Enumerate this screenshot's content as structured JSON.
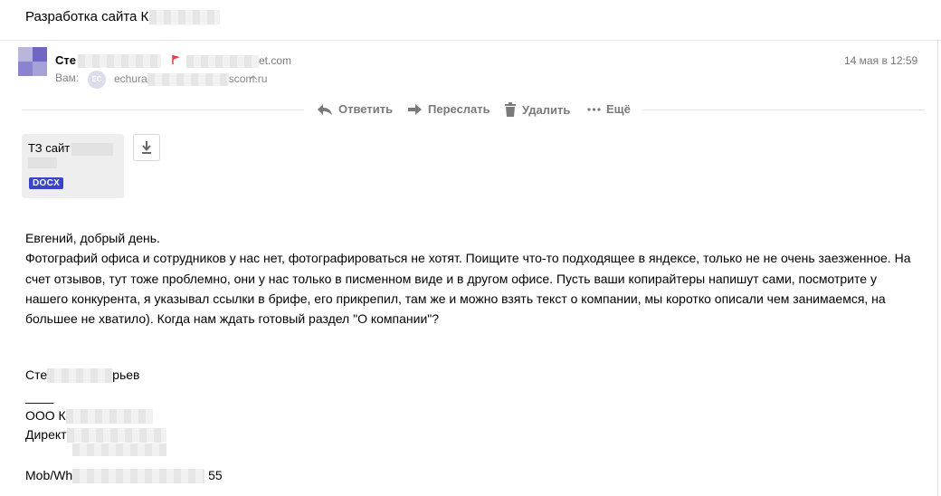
{
  "subject": {
    "text": "Разработка сайта К"
  },
  "sender": {
    "name": "Сте",
    "email_suffix": "et.com",
    "date": "14 мая в 12:59"
  },
  "recipient": {
    "label": "Вам:",
    "avatar_initials": "EC",
    "email_start": "echura",
    "email_end": "scom.ru"
  },
  "actions": {
    "reply": "Ответить",
    "forward": "Переслать",
    "delete": "Удалить",
    "more": "Ещё"
  },
  "attachment": {
    "name": "ТЗ  сайт",
    "type": "DOCX"
  },
  "message": {
    "greeting": "Евгений, добрый день.",
    "paragraph": "Фотографий офиса и сотрудников у нас нет, фотографироваться не хотят. Поищите что-то подходящее в яндексе, только не не очень заезженное. На счет отзывов, тут тоже проблемно, они у нас только в писменном виде и в другом офисе. Пусть ваши копирайтеры напишут сами, посмотрите у нашего конкурента, я указывал ссылки в брифе, его прикрепил, там же и можно взять текст о компании, мы коротко описали чем занимаемся, на большее не хватило). Когда нам ждать готовый раздел \"О компании\"?"
  },
  "signature": {
    "name_start": "Сте",
    "name_end": "рьев",
    "separator": "____",
    "company": "ООО К",
    "position": "Директ",
    "phone_start": "Mob/Wh",
    "phone_end": "55"
  },
  "colors": {
    "docx_badge": "#3a44c8",
    "action_text": "#7a7a7a",
    "meta_text": "#777777",
    "flag_icon": "#e04040"
  }
}
